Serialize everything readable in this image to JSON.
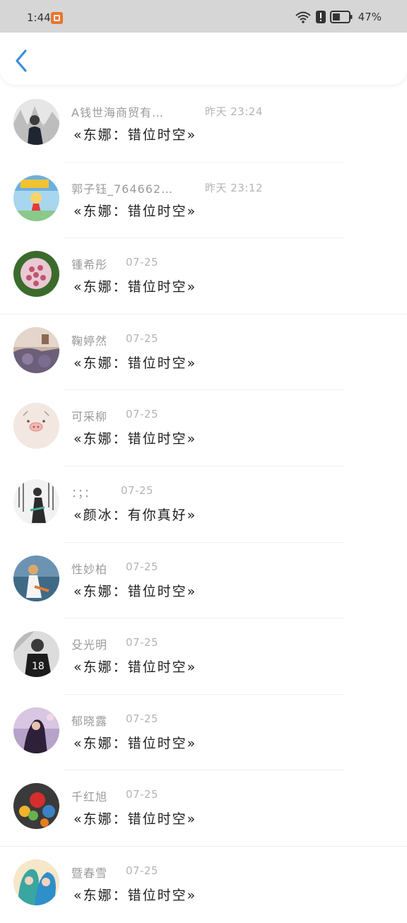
{
  "status_bar": {
    "time": "1:44",
    "battery_percent": "47%",
    "battery_level": 0.47
  },
  "header": {
    "back_icon": "chevron-left-icon",
    "accent_color": "#3a8fd8"
  },
  "items": [
    {
      "name": "A钱世海商贸有…",
      "time": "昨天 23:24",
      "message": "«东娜：错位时空»"
    },
    {
      "name": "郭子钰_764662771…",
      "time": "昨天 23:12",
      "message": "«东娜：错位时空»"
    },
    {
      "name": "锺希彤",
      "time": "07-25",
      "message": "«东娜：错位时空»"
    },
    {
      "name": "鞠婷然",
      "time": "07-25",
      "message": "«东娜：错位时空»"
    },
    {
      "name": "可采柳",
      "time": "07-25",
      "message": "«东娜：错位时空»"
    },
    {
      "name": "：；：",
      "time": "07-25",
      "message": "«颜冰：有你真好»"
    },
    {
      "name": "性妙柏",
      "time": "07-25",
      "message": "«东娜：错位时空»"
    },
    {
      "name": "殳光明",
      "time": "07-25",
      "message": "«东娜：错位时空»"
    },
    {
      "name": "郁晓露",
      "time": "07-25",
      "message": "«东娜：错位时空»"
    },
    {
      "name": "千红旭",
      "time": "07-25",
      "message": "«东娜：错位时空»"
    },
    {
      "name": "暨春雪",
      "time": "07-25",
      "message": "«东娜：错位时空»"
    }
  ]
}
